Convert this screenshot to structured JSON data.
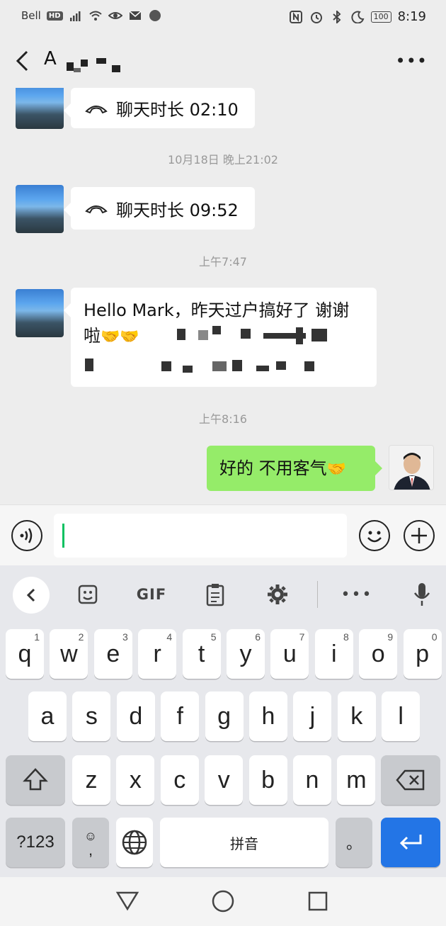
{
  "status_bar": {
    "carrier": "Bell",
    "network_badge": "HD",
    "battery": "100",
    "time": "8:19",
    "icons": [
      "signal-icon",
      "wifi-icon",
      "eye-icon",
      "mail-icon",
      "nfc-icon",
      "alarm-icon",
      "bluetooth-icon",
      "moon-icon",
      "battery-icon"
    ]
  },
  "header": {
    "title": "A",
    "back_icon": "chevron-left-icon",
    "more_label": "•••"
  },
  "messages": [
    {
      "type": "call",
      "sender": "other",
      "text": "聊天时长 02:10"
    },
    {
      "type": "time",
      "text": "10月18日 晚上21:02"
    },
    {
      "type": "call",
      "sender": "other",
      "text": "聊天时长 09:52"
    },
    {
      "type": "time",
      "text": "上午7:47"
    },
    {
      "type": "text",
      "sender": "other",
      "text": "Hello Mark，昨天过户搞好了 谢谢啦",
      "emoji": "🤝🤝"
    },
    {
      "type": "time",
      "text": "上午8:16"
    },
    {
      "type": "text",
      "sender": "me",
      "text": "好的 不用客气",
      "emoji": "🤝"
    }
  ],
  "input": {
    "value": ""
  },
  "keyboard": {
    "toolbar": {
      "gif_label": "GIF"
    },
    "row1": [
      {
        "key": "q",
        "sup": "1"
      },
      {
        "key": "w",
        "sup": "2"
      },
      {
        "key": "e",
        "sup": "3"
      },
      {
        "key": "r",
        "sup": "4"
      },
      {
        "key": "t",
        "sup": "5"
      },
      {
        "key": "y",
        "sup": "6"
      },
      {
        "key": "u",
        "sup": "7"
      },
      {
        "key": "i",
        "sup": "8"
      },
      {
        "key": "o",
        "sup": "9"
      },
      {
        "key": "p",
        "sup": "0"
      }
    ],
    "row2": [
      "a",
      "s",
      "d",
      "f",
      "g",
      "h",
      "j",
      "k",
      "l"
    ],
    "row3": [
      "z",
      "x",
      "c",
      "v",
      "b",
      "n",
      "m"
    ],
    "symbols_label": "?123",
    "emoji_comma": ",",
    "space_label": "拼音",
    "period_label": "。"
  },
  "colors": {
    "accent_green": "#95ec69",
    "caret": "#07c160",
    "enter_blue": "#2375e6"
  }
}
